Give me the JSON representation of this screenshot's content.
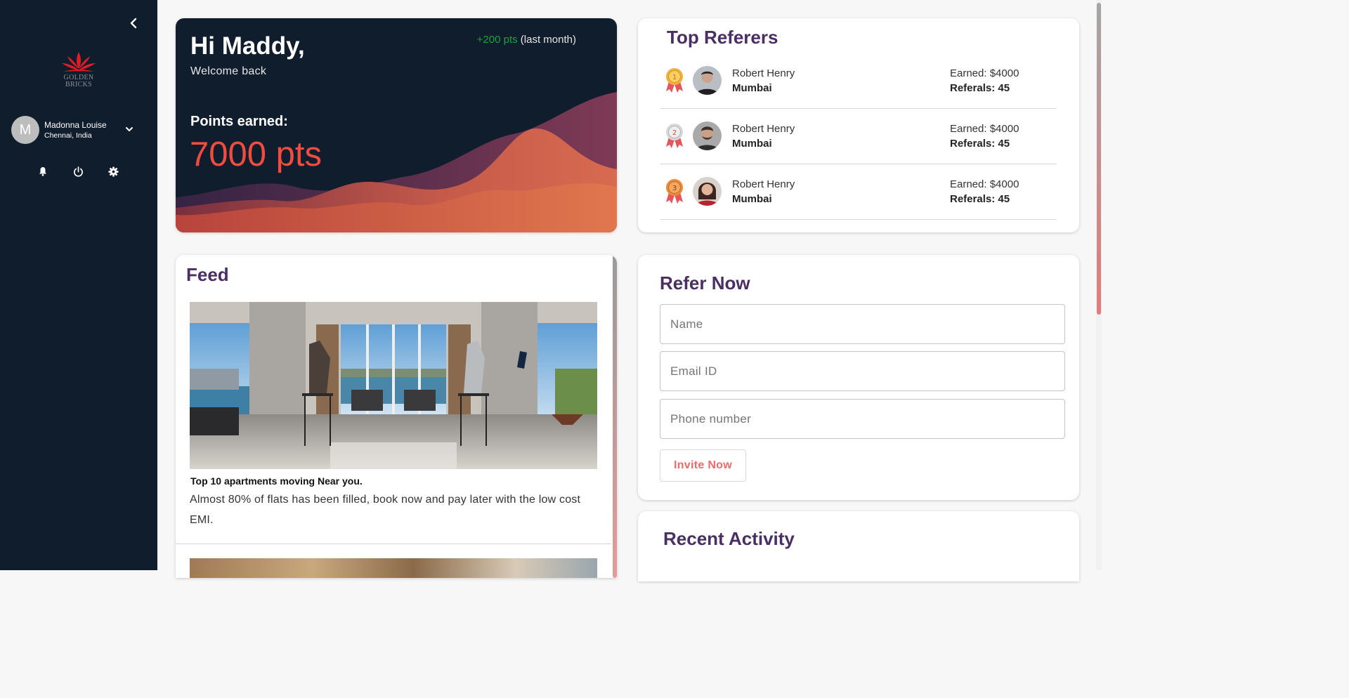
{
  "sidebar": {
    "logo_text_1": "GOLDEN",
    "logo_text_2": "BRICKS",
    "user": {
      "initial": "M",
      "name": "Madonna Louise",
      "location": "Chennai, India"
    },
    "icons": [
      "bell-icon",
      "power-icon",
      "gear-icon"
    ]
  },
  "welcome": {
    "greeting": "Hi Maddy,",
    "subtitle": "Welcome back",
    "delta_value": "+200 pts",
    "delta_period": "(last month)",
    "points_label": "Points earned:",
    "points_value": "7000 pts"
  },
  "referers": {
    "title": "Top Referers",
    "rows": [
      {
        "rank": "1",
        "name": "Robert Henry",
        "city": "Mumbai",
        "earned": "Earned: $4000",
        "referrals": "Referals: 45"
      },
      {
        "rank": "2",
        "name": "Robert Henry",
        "city": "Mumbai",
        "earned": "Earned: $4000",
        "referrals": "Referals: 45"
      },
      {
        "rank": "3",
        "name": "Robert Henry",
        "city": "Mumbai",
        "earned": "Earned: $4000",
        "referrals": "Referals: 45"
      }
    ]
  },
  "feed": {
    "title": "Feed",
    "post": {
      "caption": "Top 10 apartments moving Near you.",
      "description": "Almost 80% of flats has been filled, book now and pay later with the low cost EMI."
    }
  },
  "refer": {
    "title": "Refer Now",
    "name_placeholder": "Name",
    "email_placeholder": "Email ID",
    "phone_placeholder": "Phone number",
    "invite_label": "Invite Now"
  },
  "recent": {
    "title": "Recent Activity"
  },
  "colors": {
    "sidebar": "#101d2c",
    "accent": "#f24b3f",
    "title": "#4a2f63",
    "positive": "#18a33a",
    "invite": "#ec6a6a"
  }
}
